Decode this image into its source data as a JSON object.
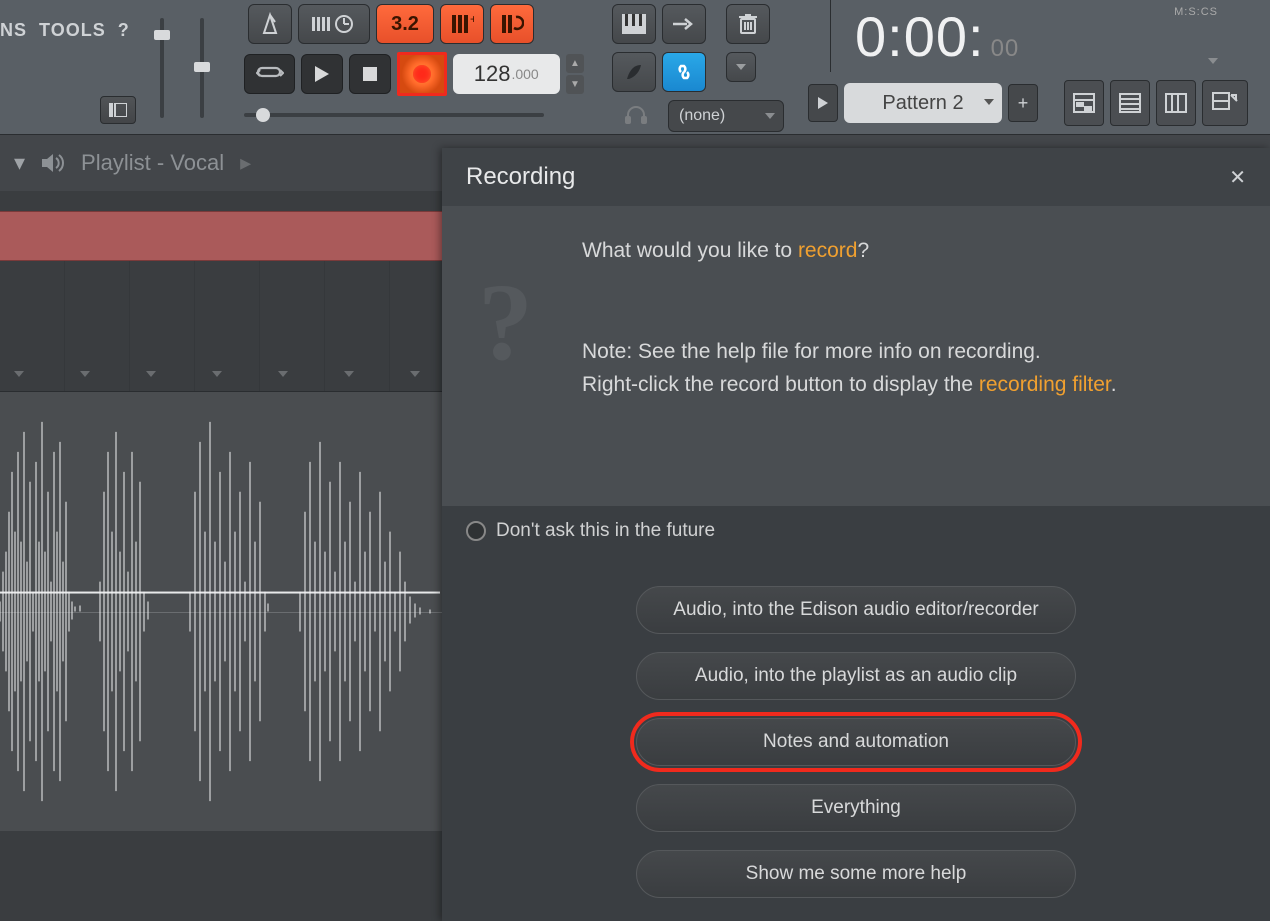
{
  "menu": {
    "item1": "NS",
    "item2": "TOOLS",
    "item3": "?"
  },
  "toolbar": {
    "timesig": "3.2",
    "tempo_int": "128",
    "tempo_dec": ".000",
    "midi_input": "(none)"
  },
  "timer": {
    "main": "0:00:",
    "frac": "00",
    "label": "M:S:CS"
  },
  "pattern": {
    "name": "Pattern 2",
    "add": "+"
  },
  "playlist": {
    "title": "Playlist - Vocal"
  },
  "dialog": {
    "title": "Recording",
    "question_prefix": "What would you like to ",
    "question_hl": "record",
    "question_suffix": "?",
    "note1": "Note: See the help file for more info on recording.",
    "note2_prefix": "Right-click the record button to display the ",
    "note2_hl": "recording filter",
    "note2_suffix": ".",
    "dont_ask": "Don't ask this in the future",
    "opt1": "Audio, into the Edison audio editor/recorder",
    "opt2": "Audio, into the playlist as an audio clip",
    "opt3": "Notes and automation",
    "opt4": "Everything",
    "opt5": "Show me some more help"
  }
}
